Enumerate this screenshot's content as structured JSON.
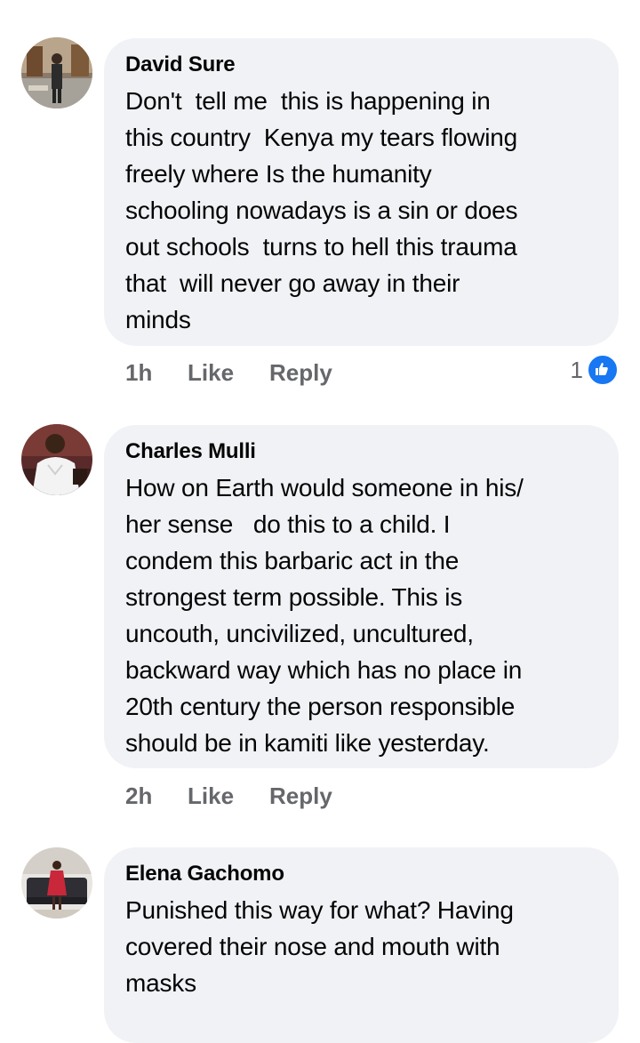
{
  "comments": [
    {
      "author": "David Sure",
      "text": "Don't  tell me  this is happening in\nthis country  Kenya my tears flowing\nfreely where Is the humanity\nschooling nowadays is a sin or does\nout schools  turns to hell this trauma\nthat  will never go away in their\nminds",
      "time": "1h",
      "like_label": "Like",
      "reply_label": "Reply",
      "reaction_count": "1",
      "reaction_icon": "like-thumb-icon"
    },
    {
      "author": "Charles Mulli",
      "text": "How on Earth would someone in his/\nher sense   do this to a child. I\ncondem this barbaric act in the\nstrongest term possible. This is\nuncouth, uncivilized, uncultured,\nbackward way which has no place in\n20th century the person responsible\nshould be in kamiti like yesterday.",
      "time": "2h",
      "like_label": "Like",
      "reply_label": "Reply"
    },
    {
      "author": "Elena Gachomo",
      "text": "Punished this way for what? Having\ncovered their nose and mouth with\nmasks"
    }
  ],
  "colors": {
    "bubble": "#f0f2f5",
    "secondary_text": "#65676b",
    "like_blue": "#1877f2"
  }
}
